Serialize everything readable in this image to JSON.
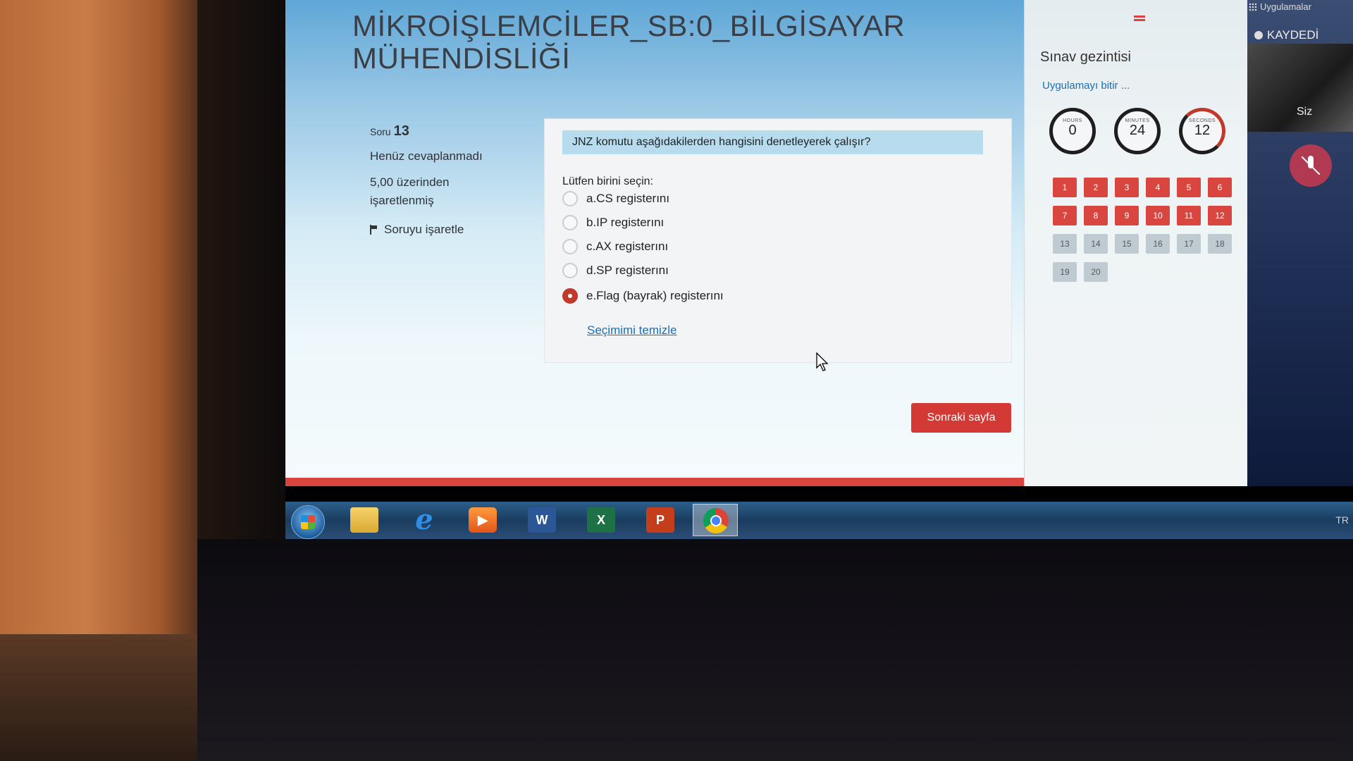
{
  "course": {
    "title": "MİKROİŞLEMCİLER_SB:0_BİLGİSAYAR MÜHENDİSLİĞİ"
  },
  "question_info": {
    "label": "Soru",
    "number": "13",
    "state": "Henüz cevaplanmadı",
    "grade": "5,00 üzerinden işaretlenmiş",
    "flag_label": "Soruyu işaretle"
  },
  "question": {
    "text": "JNZ komutu aşağıdakilerden hangisini denetleyerek çalışır?",
    "prompt": "Lütfen birini seçin:",
    "answers": [
      {
        "label": "a.CS registerını",
        "selected": false
      },
      {
        "label": "b.IP registerını",
        "selected": false
      },
      {
        "label": "c.AX registerını",
        "selected": false
      },
      {
        "label": "d.SP registerını",
        "selected": false
      },
      {
        "label": "e.Flag (bayrak) registerını",
        "selected": true
      }
    ],
    "clear_label": "Seçimimi temizle"
  },
  "next_button": "Sonraki sayfa",
  "navigation": {
    "title": "Sınav gezintisi",
    "finish_link": "Uygulamayı bitir ...",
    "timer": {
      "hours_label": "HOURS",
      "hours": "0",
      "minutes_label": "MINUTES",
      "minutes": "24",
      "seconds_label": "SECONDS",
      "seconds": "12"
    },
    "questions": [
      {
        "n": "1",
        "state": "answered"
      },
      {
        "n": "2",
        "state": "answered"
      },
      {
        "n": "3",
        "state": "answered"
      },
      {
        "n": "4",
        "state": "answered"
      },
      {
        "n": "5",
        "state": "answered"
      },
      {
        "n": "6",
        "state": "answered"
      },
      {
        "n": "7",
        "state": "answered"
      },
      {
        "n": "8",
        "state": "answered"
      },
      {
        "n": "9",
        "state": "answered"
      },
      {
        "n": "10",
        "state": "answered"
      },
      {
        "n": "11",
        "state": "answered"
      },
      {
        "n": "12",
        "state": "answered"
      },
      {
        "n": "13",
        "state": "unanswered"
      },
      {
        "n": "14",
        "state": "unanswered"
      },
      {
        "n": "15",
        "state": "unanswered"
      },
      {
        "n": "16",
        "state": "unanswered"
      },
      {
        "n": "17",
        "state": "unanswered"
      },
      {
        "n": "18",
        "state": "unanswered"
      },
      {
        "n": "19",
        "state": "unanswered"
      },
      {
        "n": "20",
        "state": "unanswered"
      }
    ]
  },
  "side": {
    "apps_label": "Uygulamalar",
    "recording_label": "KAYDEDİ",
    "self_label": "Siz"
  },
  "taskbar": {
    "items": [
      "start-orb",
      "folder-icon",
      "internet-explorer-icon",
      "media-player-icon",
      "word-icon",
      "excel-icon",
      "powerpoint-icon",
      "chrome-icon"
    ],
    "word_glyph": "W",
    "excel_glyph": "X",
    "ppt_glyph": "P",
    "ie_glyph": "e",
    "language": "TR"
  },
  "colors": {
    "accent_red": "#d33a35",
    "answered": "#d8463f",
    "unanswered": "#bfcad1",
    "link": "#1a6fb8"
  }
}
